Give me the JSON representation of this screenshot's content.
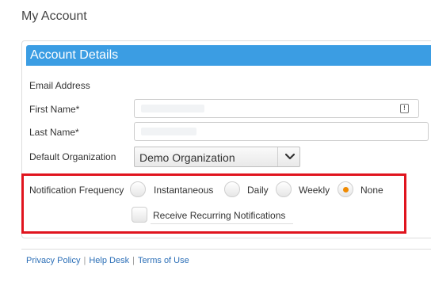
{
  "page": {
    "title": "My Account"
  },
  "panel": {
    "header": "Account Details"
  },
  "form": {
    "email_label": "Email Address",
    "first_name_label": "First Name*",
    "last_name_label": "Last Name*",
    "default_org_label": "Default Organization",
    "default_org_value": "Demo Organization"
  },
  "notifications": {
    "label": "Notification Frequency",
    "options": [
      "Instantaneous",
      "Daily",
      "Weekly",
      "None"
    ],
    "selected": "None",
    "recurring_label": "Receive Recurring Notifications",
    "recurring_checked": false
  },
  "footer": {
    "links": [
      "Privacy Policy",
      "Help Desk",
      "Terms of Use"
    ]
  },
  "colors": {
    "header": "#3b9de3",
    "highlight": "#e0141e",
    "radio_selected": "#f08a00",
    "link": "#2c6fb7"
  }
}
